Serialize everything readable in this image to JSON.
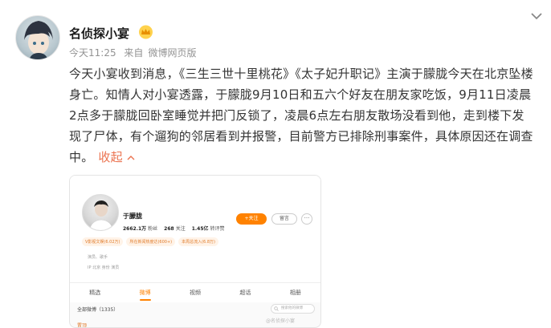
{
  "post": {
    "author": "名侦探小宴",
    "time": "今天11:25",
    "source_prefix": "来自",
    "source": "微博网页版",
    "text": "今天小宴收到消息，《三生三世十里桃花》《太子妃升职记》主演于朦胧今天在北京坠楼身亡。知情人对小宴透露，于朦胧9月10日和五六个好友在朋友家吃饭，9月11日凌晨2点多于朦胧回卧室睡觉并把门反锁了，凌晨6点左右朋友散场没看到他，走到楼下发现了尸体，有个遛狗的邻居看到并报警，目前警方已排除刑事案件，具体原因还在调查中。",
    "collapse_label": "收起"
  },
  "embed": {
    "name": "于朦胧",
    "stats": [
      {
        "value": "2662.1万",
        "label": "粉丝"
      },
      {
        "value": "268",
        "label": "关注"
      },
      {
        "value": "1.45亿",
        "label": "转评赞"
      }
    ],
    "follow_label": "+关注",
    "message_label": "留言",
    "more_label": "···",
    "tags": [
      "V影视文娱(6.02万)",
      "所在新闻热度达(600+)",
      "本周总流入(6.8万)"
    ],
    "line1": "演员、歌手",
    "line2": "IP 北京    身份 演员",
    "tabs": [
      "精选",
      "微博",
      "视频",
      "超话",
      "相册"
    ],
    "feed_label": "全部微博（1335）",
    "search_placeholder": "搜索他的微博",
    "watermark": "@名侦探小宴",
    "bottom_item": "置顶"
  },
  "colors": {
    "accent": "#ff8200",
    "link": "#eb7350",
    "meta": "#939393"
  }
}
